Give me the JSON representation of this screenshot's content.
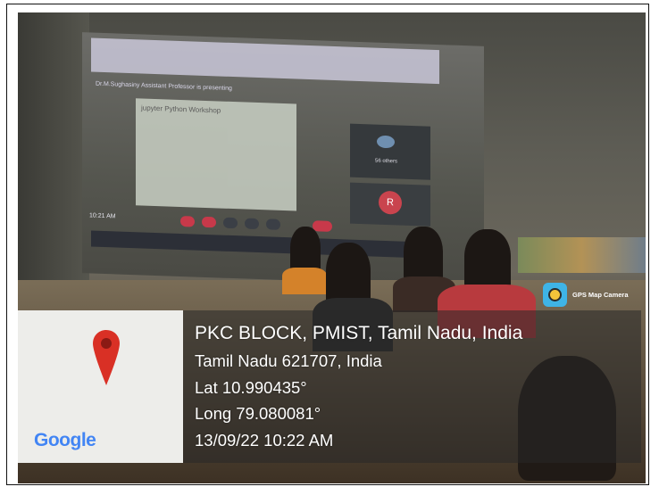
{
  "watermark": {
    "app_label": "GPS Map Camera",
    "location_title": "PKC BLOCK, PMIST, Tamil Nadu, India",
    "address": "Tamil Nadu 621707, India",
    "latitude": "Lat 10.990435°",
    "longitude": "Long 79.080081°",
    "datetime": "13/09/22 10:22 AM",
    "map_logo": "Google",
    "pin_color": "#d93025"
  },
  "projected_screen": {
    "presenter_banner": "Dr.M.Sughasiny Assistant Professor is presenting",
    "notebook_title": "jupyter   Python Workshop",
    "meet_time": "10:21 AM",
    "avatar_letter": "R",
    "participants_label": "56 others"
  }
}
